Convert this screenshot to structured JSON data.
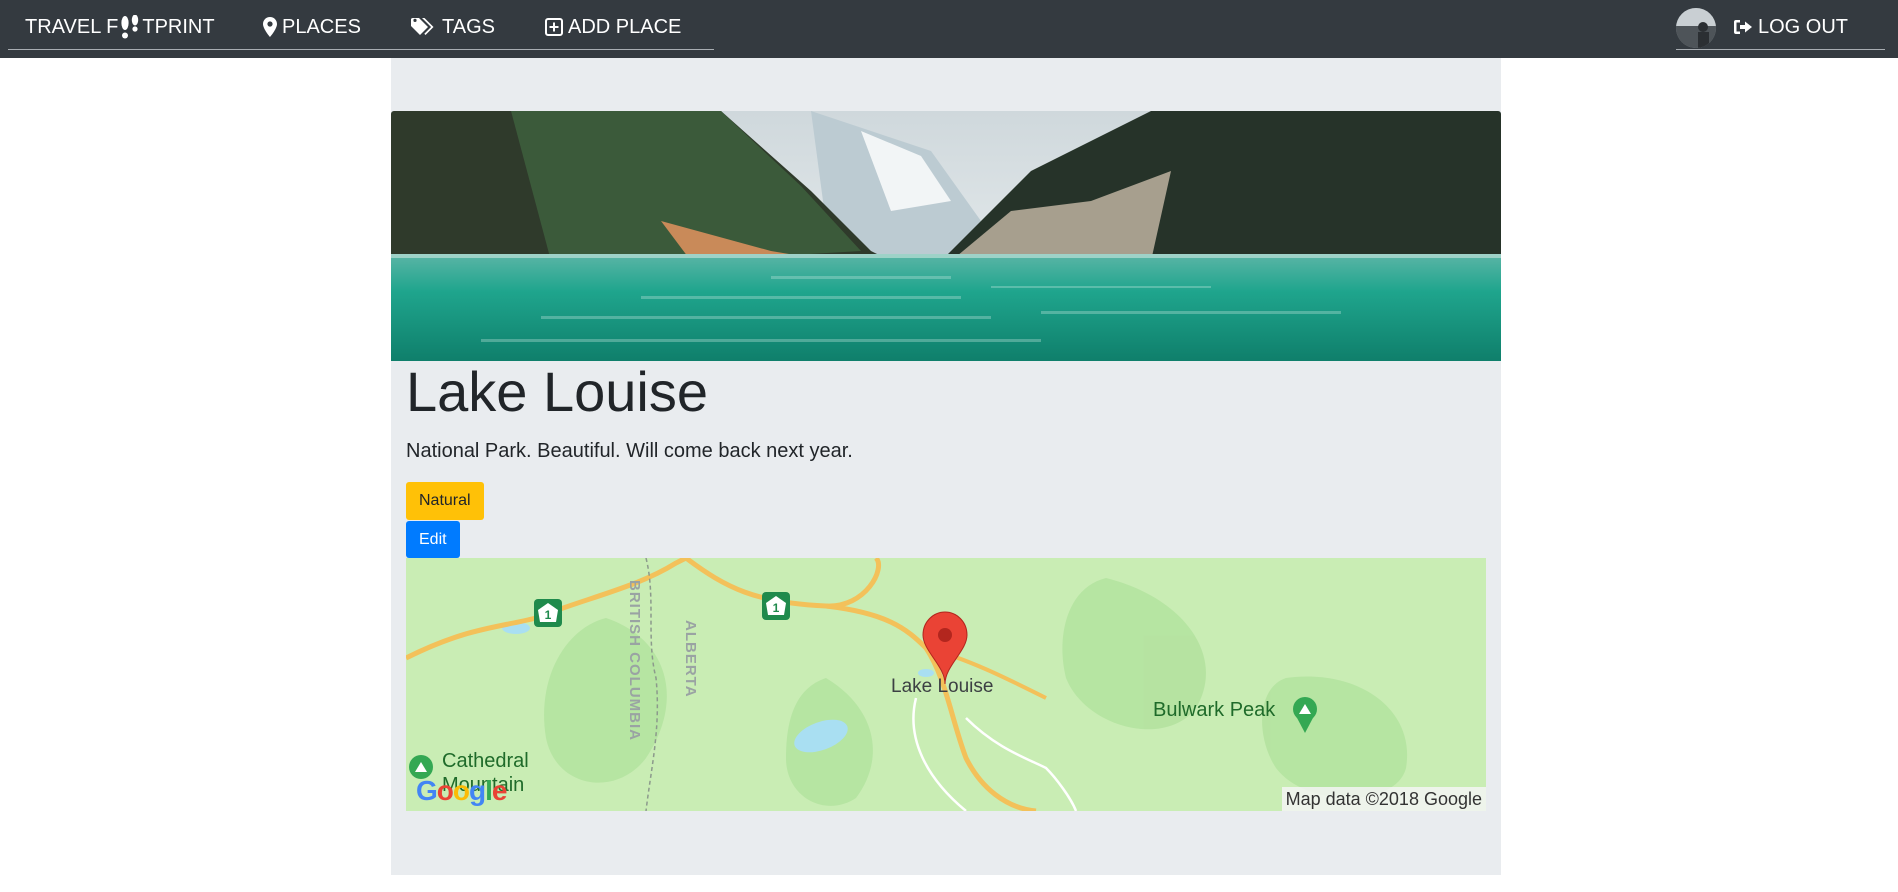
{
  "nav": {
    "brand_before": "TRAVEL F",
    "brand_after": "TPRINT",
    "places": "PLACES",
    "tags": "TAGS",
    "add_place": "ADD PLACE",
    "logout": "LOG OUT",
    "icons": {
      "brand": "footprints-icon",
      "places": "map-marker-icon",
      "tags": "tags-icon",
      "add_place": "plus-square-icon",
      "logout": "sign-out-icon"
    }
  },
  "place": {
    "title": "Lake Louise",
    "description": "National Park. Beautiful. Will come back next year.",
    "tag": "Natural",
    "edit": "Edit"
  },
  "map": {
    "marker_label": "Lake Louise",
    "peak_label": "Bulwark Peak",
    "cathedral_label_1": "Cathedral",
    "cathedral_label_2": "Mountain",
    "province_bc": "BRITISH COLUMBIA",
    "province_ab": "ALBERTA",
    "highway_number": "1",
    "attribution": "Map data ©2018 Google",
    "logo_text": "Google"
  },
  "colors": {
    "navbar": "#343a40",
    "jumbotron": "#e9ecef",
    "tag_warning": "#ffc107",
    "primary": "#007bff",
    "map_land": "#c9edb4",
    "marker": "#ea4335"
  }
}
